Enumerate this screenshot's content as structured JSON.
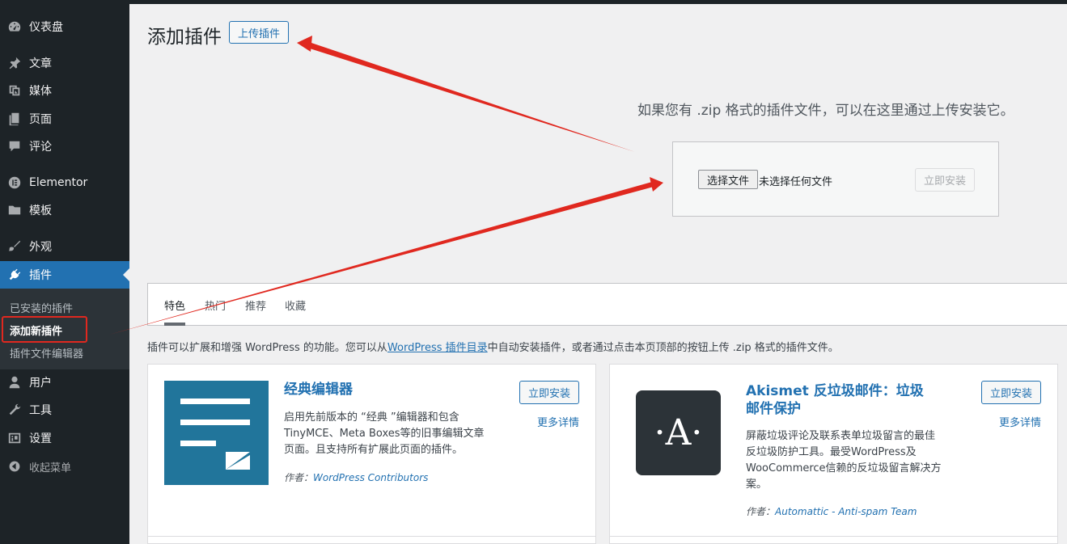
{
  "sidebar": {
    "items": [
      {
        "label": "仪表盘",
        "icon": "dashboard-icon"
      },
      {
        "label": "文章",
        "icon": "pin-icon"
      },
      {
        "label": "媒体",
        "icon": "media-icon"
      },
      {
        "label": "页面",
        "icon": "page-icon"
      },
      {
        "label": "评论",
        "icon": "comment-icon"
      },
      {
        "label": "Elementor",
        "icon": "elementor-icon"
      },
      {
        "label": "模板",
        "icon": "folder-icon"
      },
      {
        "label": "外观",
        "icon": "brush-icon"
      },
      {
        "label": "插件",
        "icon": "plugin-icon"
      },
      {
        "label": "用户",
        "icon": "user-icon"
      },
      {
        "label": "工具",
        "icon": "wrench-icon"
      },
      {
        "label": "设置",
        "icon": "settings-icon"
      }
    ],
    "submenu": [
      {
        "label": "已安装的插件"
      },
      {
        "label": "添加新插件"
      },
      {
        "label": "插件文件编辑器"
      }
    ],
    "collapse_label": "收起菜单"
  },
  "header": {
    "title": "添加插件",
    "upload_button": "上传插件"
  },
  "upload": {
    "help_text": "如果您有 .zip 格式的插件文件，可以在这里通过上传安装它。",
    "choose_file": "选择文件",
    "no_file": "未选择任何文件",
    "install_now": "立即安装"
  },
  "tabs": [
    {
      "label": "特色"
    },
    {
      "label": "热门"
    },
    {
      "label": "推荐"
    },
    {
      "label": "收藏"
    }
  ],
  "intro": {
    "before": "插件可以扩展和增强 WordPress 的功能。您可以从",
    "link": "WordPress 插件目录",
    "after": "中自动安装插件，或者通过点击本页顶部的按钮上传 .zip 格式的插件文件。"
  },
  "plugins": [
    {
      "title": "经典编辑器",
      "desc": [
        "启用先前版本的 “经典 ”编辑器和包含",
        "TinyMCE、Meta Boxes等的旧事编辑文章",
        "页面。且支持所有扩展此页面的插件。"
      ],
      "author_prefix": "作者：",
      "author": "WordPress Contributors",
      "install": "立即安装",
      "more": "更多详情",
      "icon_color": "#21759b"
    },
    {
      "title_lines": [
        "Akismet 反垃圾邮件：垃圾",
        "邮件保护"
      ],
      "logo_letter": "·A·",
      "desc": [
        "屏蔽垃圾评论及联系表单垃圾留言的最佳",
        "反垃圾防护工具。最受WordPress及",
        "WooCommerce信赖的反垃圾留言解决方",
        "案。"
      ],
      "author_prefix": "作者：",
      "author": "Automattic - Anti-spam Team",
      "install": "立即安装",
      "more": "更多详情",
      "icon_color": "#2c3338"
    }
  ],
  "colors": {
    "accent": "#2271b1",
    "sidebar_bg": "#1d2327",
    "annotation_red": "#e0281f"
  }
}
